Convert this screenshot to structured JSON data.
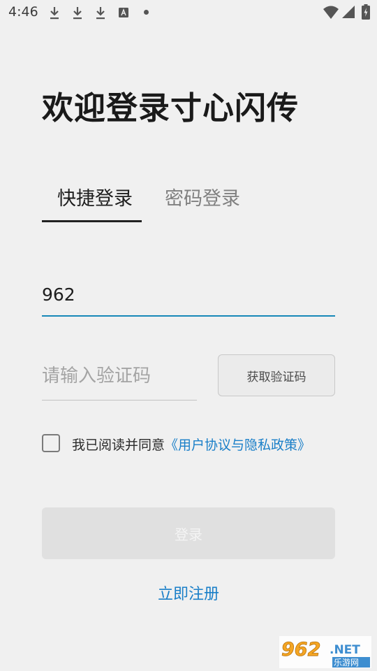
{
  "status_bar": {
    "time": "4:46",
    "icons": [
      "download-icon",
      "download-icon",
      "download-icon",
      "a-icon",
      "dot-icon",
      "wifi-icon",
      "signal-icon",
      "battery-icon"
    ]
  },
  "header": {
    "title": "欢迎登录寸心闪传"
  },
  "tabs": [
    {
      "label": "快捷登录",
      "active": true
    },
    {
      "label": "密码登录",
      "active": false
    }
  ],
  "form": {
    "phone_value": "962",
    "code_placeholder": "请输入验证码",
    "get_code_label": "获取验证码"
  },
  "agreement": {
    "text": "我已阅读并同意",
    "link": "《用户协议与隐私政策》",
    "checked": false
  },
  "login_label": "登录",
  "register_label": "立即注册",
  "watermark": {
    "brand": "962",
    "net": ".NET",
    "cn": "乐游网"
  },
  "colors": {
    "accent": "#1a7fc8",
    "underline_active": "#1788b8",
    "background": "#f0f0f0"
  }
}
